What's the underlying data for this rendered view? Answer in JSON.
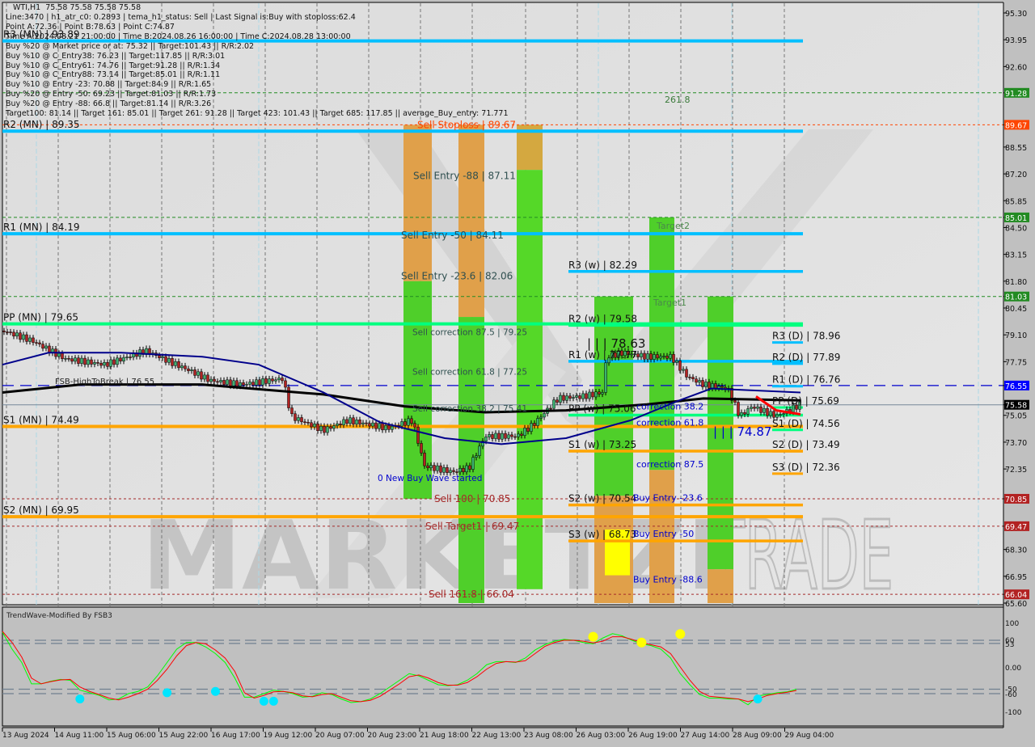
{
  "window": {
    "symbol": "WTI,H1",
    "ohlc": "75.58 75.58 75.58 75.58"
  },
  "info_panel": [
    "Line:3470 | h1_atr_c0: 0.2893 | tema_h1_status: Sell | Last Signal is:Buy with stoploss:62.4",
    "Point A:72.36 | Point B:78.63 | Point C:74.87",
    "Time A:2024.08.21 21:00:00 | Time B:2024.08.26 16:00:00 | Time C:2024.08.28 13:00:00",
    "Buy %20 @ Market price or at: 75.32 || Target:101.43 || R/R:2.02",
    "Buy %10 @ C_Entry38: 76.23 || Target:117.85 || R/R:3.01",
    "Buy %10 @ C_Entry61: 74.76 || Target:91.28 || R/R:1.34",
    "Buy %10 @ C_Entry88: 73.14 || Target:85.01 || R/R:1.11",
    "Buy %10 @ Entry -23: 70.88 || Target:84.9 || R/R:1.65",
    "Buy %20 @ Entry -50: 69.23 || Target:81.03 || R/R:1.73",
    "Buy %20 @ Entry -88: 66.8 || Target:81.14 || R/R:3.26",
    "Target100: 81.14 || Target 161: 85.01 || Target 261: 91.28 || Target 423: 101.43 || Target 685: 117.85 || average_Buy_entry: 71.771"
  ],
  "watermark": {
    "left": "MARKETZI",
    "right": "TRADE"
  },
  "chart_data": {
    "type": "candlestick",
    "title": "WTI,H1",
    "ylim": [
      65.6,
      95.3
    ],
    "y_ticks": [
      "95.30",
      "93.95",
      "92.60",
      "91.28",
      "89.67",
      "88.55",
      "87.20",
      "85.85",
      "85.01",
      "84.50",
      "83.15",
      "81.80",
      "81.03",
      "80.45",
      "79.10",
      "77.75",
      "76.55",
      "75.58",
      "75.05",
      "73.70",
      "72.35",
      "70.85",
      "69.47",
      "68.30",
      "66.95",
      "66.04",
      "65.60"
    ],
    "y_tick_values": [
      95.3,
      93.95,
      92.6,
      91.28,
      89.67,
      88.55,
      87.2,
      85.85,
      85.01,
      84.5,
      83.15,
      81.8,
      81.03,
      80.45,
      79.1,
      77.75,
      76.55,
      75.58,
      75.05,
      73.7,
      72.35,
      70.85,
      69.47,
      68.3,
      66.95,
      66.04,
      65.6
    ],
    "price_labels": [
      {
        "value": 91.28,
        "text": "91.28",
        "color": "#228b22"
      },
      {
        "value": 89.67,
        "text": "89.67",
        "color": "#ff4500"
      },
      {
        "value": 85.01,
        "text": "85.01",
        "color": "#228b22"
      },
      {
        "value": 81.03,
        "text": "81.03",
        "color": "#228b22"
      },
      {
        "value": 76.55,
        "text": "76.55",
        "color": "#0000ff"
      },
      {
        "value": 75.58,
        "text": "75.58",
        "color": "#000000"
      },
      {
        "value": 70.85,
        "text": "70.85",
        "color": "#b22222"
      },
      {
        "value": 69.47,
        "text": "69.47",
        "color": "#b22222"
      },
      {
        "value": 66.04,
        "text": "66.04",
        "color": "#b22222"
      }
    ],
    "x_ticks": [
      "13 Aug 2024",
      "14 Aug 11:00",
      "15 Aug 06:00",
      "15 Aug 22:00",
      "16 Aug 17:00",
      "19 Aug 12:00",
      "20 Aug 07:00",
      "20 Aug 23:00",
      "21 Aug 18:00",
      "22 Aug 13:00",
      "23 Aug 08:00",
      "26 Aug 03:00",
      "26 Aug 19:00",
      "27 Aug 14:00",
      "28 Aug 09:00",
      "29 Aug 04:00"
    ],
    "monthly_levels": [
      {
        "label": "R3 (MN) | 93.89",
        "value": 93.89,
        "color": "#00bfff"
      },
      {
        "label": "R2 (MN) | 89.35",
        "value": 89.35,
        "color": "#00bfff"
      },
      {
        "label": "R1 (MN) | 84.19",
        "value": 84.19,
        "color": "#00bfff"
      },
      {
        "label": "PP (MN) | 79.65",
        "value": 79.65,
        "color": "#00ff7f"
      },
      {
        "label": "S1 (MN) | 74.49",
        "value": 74.49,
        "color": "#ffa500"
      },
      {
        "label": "S2 (MN) | 69.95",
        "value": 69.95,
        "color": "#ffa500"
      }
    ],
    "weekly_levels": [
      {
        "label": "R3 (w) | 82.29",
        "value": 82.29,
        "color": "#00bfff"
      },
      {
        "label": "R2 (w) | 79.58",
        "value": 79.58,
        "color": "#00ff7f"
      },
      {
        "label": "R1 (w) | 77.77",
        "value": 77.77,
        "color": "#00bfff"
      },
      {
        "label": "PP (w) | 75.06",
        "value": 75.06,
        "color": "#00ff7f"
      },
      {
        "label": "S1 (w) | 73.25",
        "value": 73.25,
        "color": "#ffa500"
      },
      {
        "label": "S2 (w) | 70.54",
        "value": 70.54,
        "color": "#ffa500"
      },
      {
        "label": "S3 (w) | 68.73",
        "value": 68.73,
        "color": "#ffa500"
      }
    ],
    "daily_levels": [
      {
        "label": "R3 (D) | 78.96",
        "value": 78.96,
        "color": "#00bfff"
      },
      {
        "label": "R2 (D) | 77.89",
        "value": 77.89,
        "color": "#00bfff"
      },
      {
        "label": "R1 (D) | 76.76",
        "value": 76.76,
        "color": "#00bfff"
      },
      {
        "label": "PP (D) | 75.69",
        "value": 75.69,
        "color": "#00ff7f"
      },
      {
        "label": "S1 (D) | 74.56",
        "value": 74.56,
        "color": "#00ff7f"
      },
      {
        "label": "S2 (D) | 73.49",
        "value": 73.49,
        "color": "#ffa500"
      },
      {
        "label": "S3 (D) | 72.36",
        "value": 72.36,
        "color": "#ffa500"
      }
    ],
    "sell_annotations": [
      {
        "text": "Sell Stoploss | 89.67",
        "value": 89.67,
        "color": "#ff4500"
      },
      {
        "text": "Sell Entry -88 | 87.11",
        "value": 87.11,
        "color": "#2f4f4f"
      },
      {
        "text": "Sell Entry -50 | 84.11",
        "value": 84.11,
        "color": "#2f4f4f"
      },
      {
        "text": "Sell Entry -23.6 | 82.06",
        "value": 82.06,
        "color": "#2f4f4f"
      },
      {
        "text": "Sell correction 87.5 | 79.25",
        "value": 79.25,
        "color": "#2f4f4f"
      },
      {
        "text": "Sell correction 61.8 | 77.25",
        "value": 77.25,
        "color": "#2f4f4f"
      },
      {
        "text": "Sell correction 38.2 | 75.41",
        "value": 75.41,
        "color": "#2f4f4f"
      },
      {
        "text": "Sell 100 | 70.85",
        "value": 70.85,
        "color": "#a52a2a"
      },
      {
        "text": "Sell Target1 | 69.47",
        "value": 69.47,
        "color": "#a52a2a"
      },
      {
        "text": "Sell 161.8 | 66.04",
        "value": 66.04,
        "color": "#a52a2a"
      }
    ],
    "buy_annotations": [
      {
        "text": "correction 38.2",
        "value": 75.5
      },
      {
        "text": "correction 61.8",
        "value": 74.7
      },
      {
        "text": "correction 87.5",
        "value": 72.6
      },
      {
        "text": "Buy Entry -23.6",
        "value": 70.9
      },
      {
        "text": "Buy Entry -50",
        "value": 69.1
      },
      {
        "text": "Buy Entry -88.6",
        "value": 66.8
      }
    ],
    "other_labels": {
      "fsb": "FSB-HighToBreak | 76.55",
      "new_wave": "0 New Buy Wave started",
      "point_b": "| | | 78.63",
      "point_c": "| | | 74.87",
      "fib_261": "261.8",
      "target2": "Target2",
      "target1": "Target1"
    },
    "target_lines": [
      91.28,
      85.01,
      81.03
    ],
    "red_dotted_lines": [
      89.67,
      70.85,
      69.47,
      66.04
    ],
    "fsb_line": 76.55,
    "last_price": 75.58,
    "oscillator": {
      "title": "TrendWave-Modified By FSB3",
      "ylim": [
        -100,
        100
      ],
      "y_ticks": [
        "100",
        "60",
        "53",
        "0.00",
        "-50",
        "-60",
        "-100"
      ],
      "levels": [
        60,
        53,
        -50,
        -60
      ],
      "green_series": [
        78,
        40,
        10,
        -38,
        -38,
        -32,
        -28,
        -30,
        -52,
        -58,
        -64,
        -74,
        -72,
        -60,
        -55,
        -45,
        -20,
        10,
        40,
        55,
        55,
        45,
        30,
        10,
        -25,
        -68,
        -68,
        -60,
        -52,
        -55,
        -60,
        -68,
        -66,
        -58,
        -62,
        -72,
        -80,
        -78,
        -72,
        -60,
        -45,
        -30,
        -15,
        -20,
        -30,
        -40,
        -42,
        -40,
        -30,
        -15,
        5,
        12,
        12,
        10,
        20,
        38,
        50,
        58,
        62,
        60,
        55,
        52,
        65,
        75,
        70,
        60,
        52,
        48,
        40,
        20,
        -15,
        -40,
        -62,
        -70,
        -70,
        -72,
        -72,
        -85,
        -65,
        -62,
        -58,
        -56,
        -50
      ],
      "red_series": [
        80,
        55,
        22,
        -25,
        -38,
        -33,
        -29,
        -28,
        -45,
        -55,
        -62,
        -70,
        -74,
        -68,
        -60,
        -50,
        -30,
        -5,
        25,
        48,
        55,
        52,
        38,
        20,
        -10,
        -58,
        -70,
        -64,
        -56,
        -55,
        -58,
        -65,
        -67,
        -62,
        -60,
        -68,
        -76,
        -78,
        -75,
        -66,
        -52,
        -38,
        -22,
        -18,
        -25,
        -35,
        -41,
        -41,
        -35,
        -22,
        -5,
        8,
        12,
        11,
        14,
        30,
        46,
        55,
        60,
        60,
        58,
        54,
        58,
        68,
        68,
        62,
        55,
        50,
        45,
        30,
        0,
        -30,
        -55,
        -66,
        -68,
        -70,
        -72,
        -78,
        -72,
        -64,
        -60,
        -57,
        -53
      ],
      "cyan_dots": [
        [
          8,
          -72
        ],
        [
          17,
          -58
        ],
        [
          22,
          -55
        ],
        [
          27,
          -77
        ],
        [
          28,
          -77
        ],
        [
          78,
          -72
        ]
      ],
      "yellow_dots": [
        [
          61,
          68
        ],
        [
          66,
          55
        ],
        [
          70,
          74
        ]
      ]
    }
  }
}
